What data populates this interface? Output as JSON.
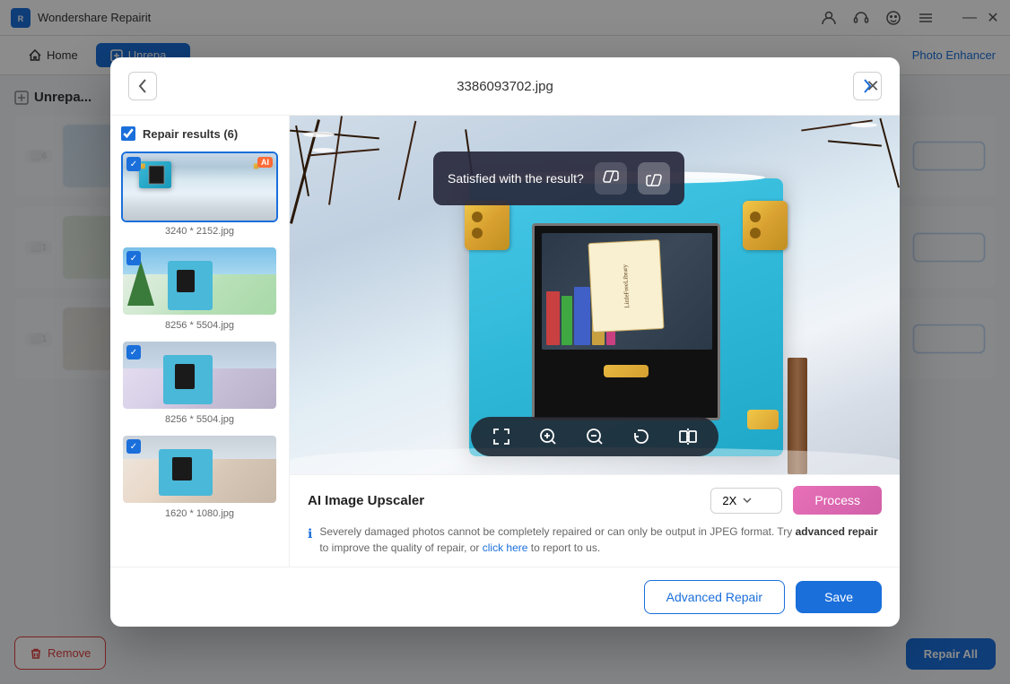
{
  "app": {
    "title": "Wondershare Repairit",
    "logo": "R"
  },
  "titlebar": {
    "title": "Wondershare Repairit",
    "controls": {
      "minimize": "—",
      "close": "✕"
    }
  },
  "navbar": {
    "home_label": "Home",
    "active_label": "Unrepa...",
    "photo_enhancer": "Photo Enhancer"
  },
  "section": {
    "title": "Unrepa..."
  },
  "modal": {
    "filename": "3386093702.jpg",
    "close_label": "✕",
    "nav_prev": "‹",
    "nav_next": "›",
    "panel_title": "Repair results (6)",
    "thumbnails": [
      {
        "label": "3240 * 2152.jpg",
        "selected": true,
        "has_ai": true,
        "variant": "v1"
      },
      {
        "label": "8256 * 5504.jpg",
        "selected": true,
        "has_ai": false,
        "variant": "v2"
      },
      {
        "label": "8256 * 5504.jpg",
        "selected": true,
        "has_ai": false,
        "variant": "v3"
      },
      {
        "label": "1620 * 1080.jpg",
        "selected": true,
        "has_ai": false,
        "variant": "v4"
      }
    ],
    "satisfied_text": "Satisfied with the result?",
    "thumb_down": "👎",
    "thumb_up": "👍",
    "toolbar": {
      "fullscreen": "⛶",
      "zoom_in": "⊕",
      "zoom_out": "⊖",
      "rotate": "⟲",
      "flip": "⬜"
    },
    "upscaler_label": "AI Image Upscaler",
    "upscaler_value": "2X",
    "process_label": "Process",
    "info_text_before": "Severely damaged photos cannot be completely repaired or can only be output in JPEG format. Try ",
    "info_link_text": "advanced repair",
    "info_text_mid": " to improve the quality of repair, or ",
    "info_click_here": "click here",
    "info_text_after": " to report to us.",
    "advanced_repair_label": "Advanced Repair",
    "save_label": "Save"
  },
  "background": {
    "remove_label": "Remove",
    "repair_all_label": "Repair All"
  }
}
